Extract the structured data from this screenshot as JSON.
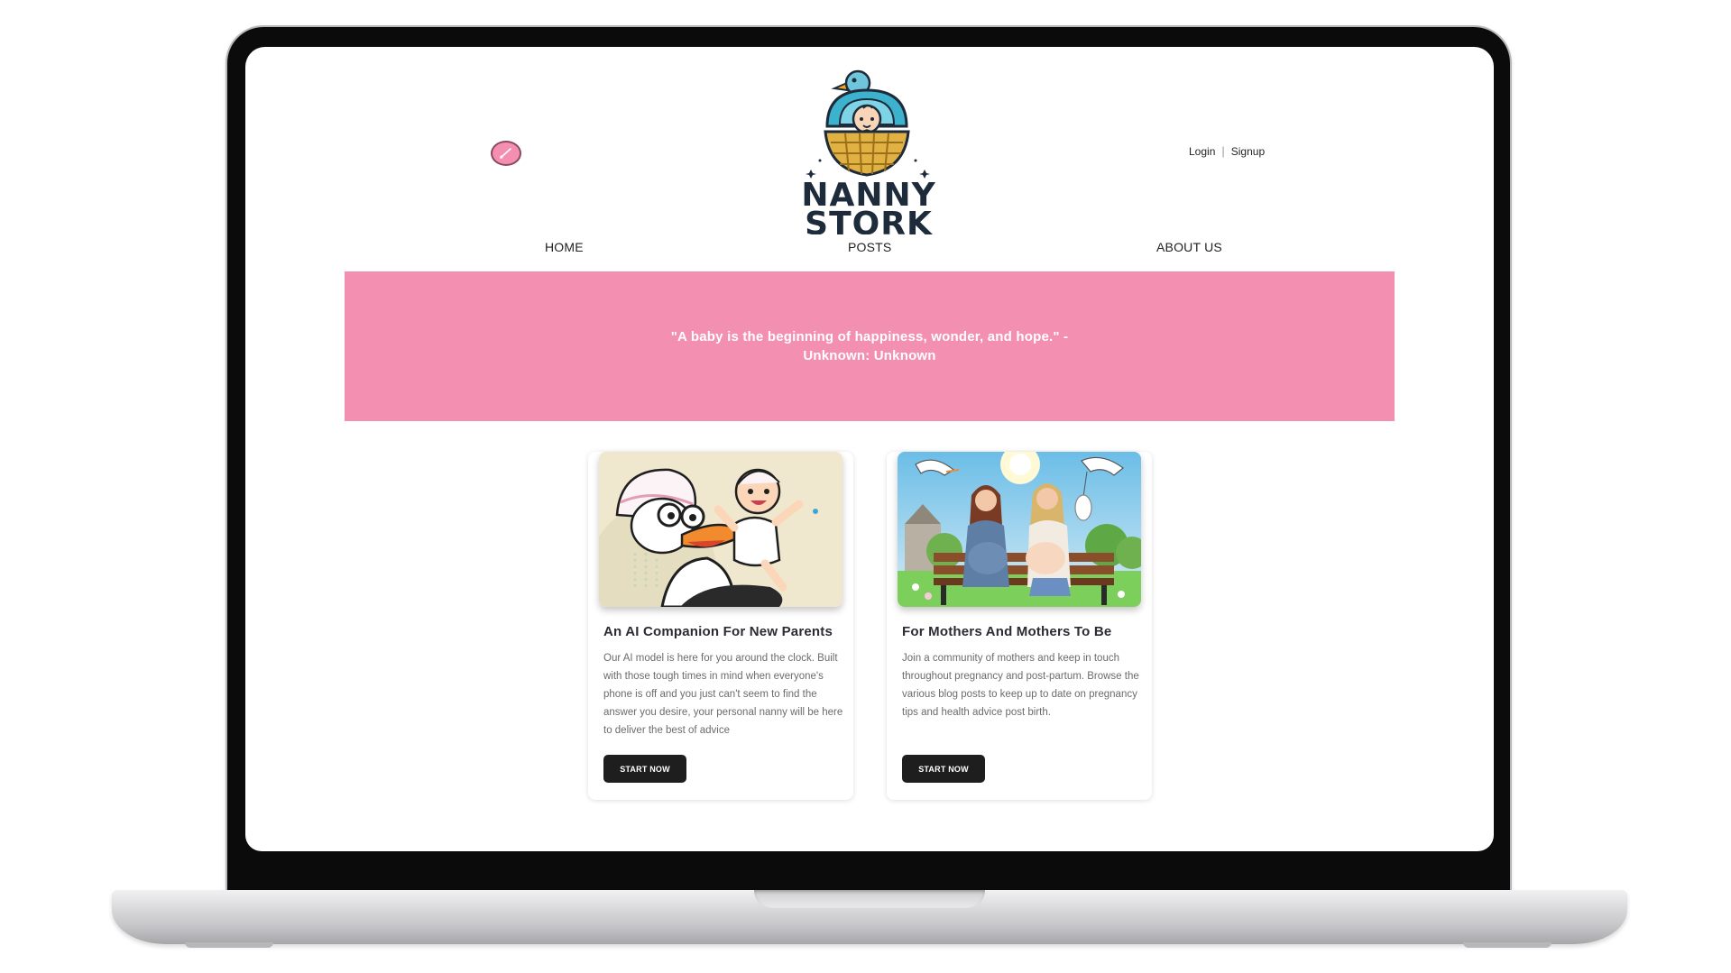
{
  "header": {
    "logo_line1": "NANNY",
    "logo_line2": "STORK",
    "login_label": "Login",
    "separator": "|",
    "signup_label": "Signup",
    "theme_toggle_icon": "paint-brush-icon"
  },
  "nav": {
    "items": [
      {
        "label": "HOME"
      },
      {
        "label": "POSTS"
      },
      {
        "label": "ABOUT US"
      }
    ]
  },
  "banner": {
    "quote_line1": "\"A baby is the beginning of happiness, wonder, and hope.\" -",
    "quote_line2": "Unknown: Unknown",
    "color": "#f38fb1"
  },
  "cards": [
    {
      "title": "An AI Companion For New Parents",
      "body": "Our AI model is here for you around the clock. Built with those tough times in mind when everyone's phone is off and you just can't seem to find the answer you desire, your personal nanny will be here to deliver the best of advice",
      "button_label": "START NOW"
    },
    {
      "title": "For Mothers And Mothers To Be",
      "body": "Join a community of mothers and keep in touch throughout pregnancy and post-partum. Browse the various blog posts to keep up to date on pregnancy tips and health advice post birth.",
      "button_label": "START NOW"
    }
  ]
}
